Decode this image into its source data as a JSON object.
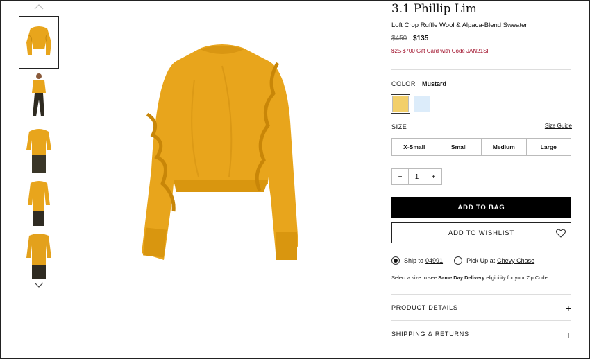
{
  "product": {
    "brand": "3.1 Phillip Lim",
    "name": "Loft Crop Ruffle Wool & Alpaca-Blend Sweater",
    "price_original": "$450",
    "price_sale": "$135",
    "promo": "$25-$700 Gift Card with Code JAN21SF"
  },
  "color": {
    "label": "COLOR",
    "selected": "Mustard",
    "swatches": [
      {
        "name": "Mustard",
        "hex": "#f2cf6a"
      },
      {
        "name": "Light Blue",
        "hex": "#dcecfa"
      }
    ]
  },
  "size": {
    "label": "SIZE",
    "guide": "Size Guide",
    "options": [
      "X-Small",
      "Small",
      "Medium",
      "Large"
    ]
  },
  "quantity": {
    "minus": "−",
    "value": "1",
    "plus": "+"
  },
  "actions": {
    "add_to_bag": "ADD TO BAG",
    "add_to_wishlist": "ADD TO WISHLIST"
  },
  "fulfillment": {
    "ship_label": "Ship to",
    "ship_zip": "04991",
    "pickup_label": "Pick Up at",
    "pickup_store": "Chevy Chase",
    "sdd_prefix": "Select a size to see",
    "sdd_bold": "Same Day Delivery",
    "sdd_suffix": "eligibility for your Zip Code"
  },
  "accordion": {
    "details": "PRODUCT DETAILS",
    "shipping": "SHIPPING & RETURNS",
    "plus": "+"
  },
  "colors": {
    "sweater": "#e8a51c",
    "promo": "#a0102a",
    "button_bg": "#000000"
  }
}
